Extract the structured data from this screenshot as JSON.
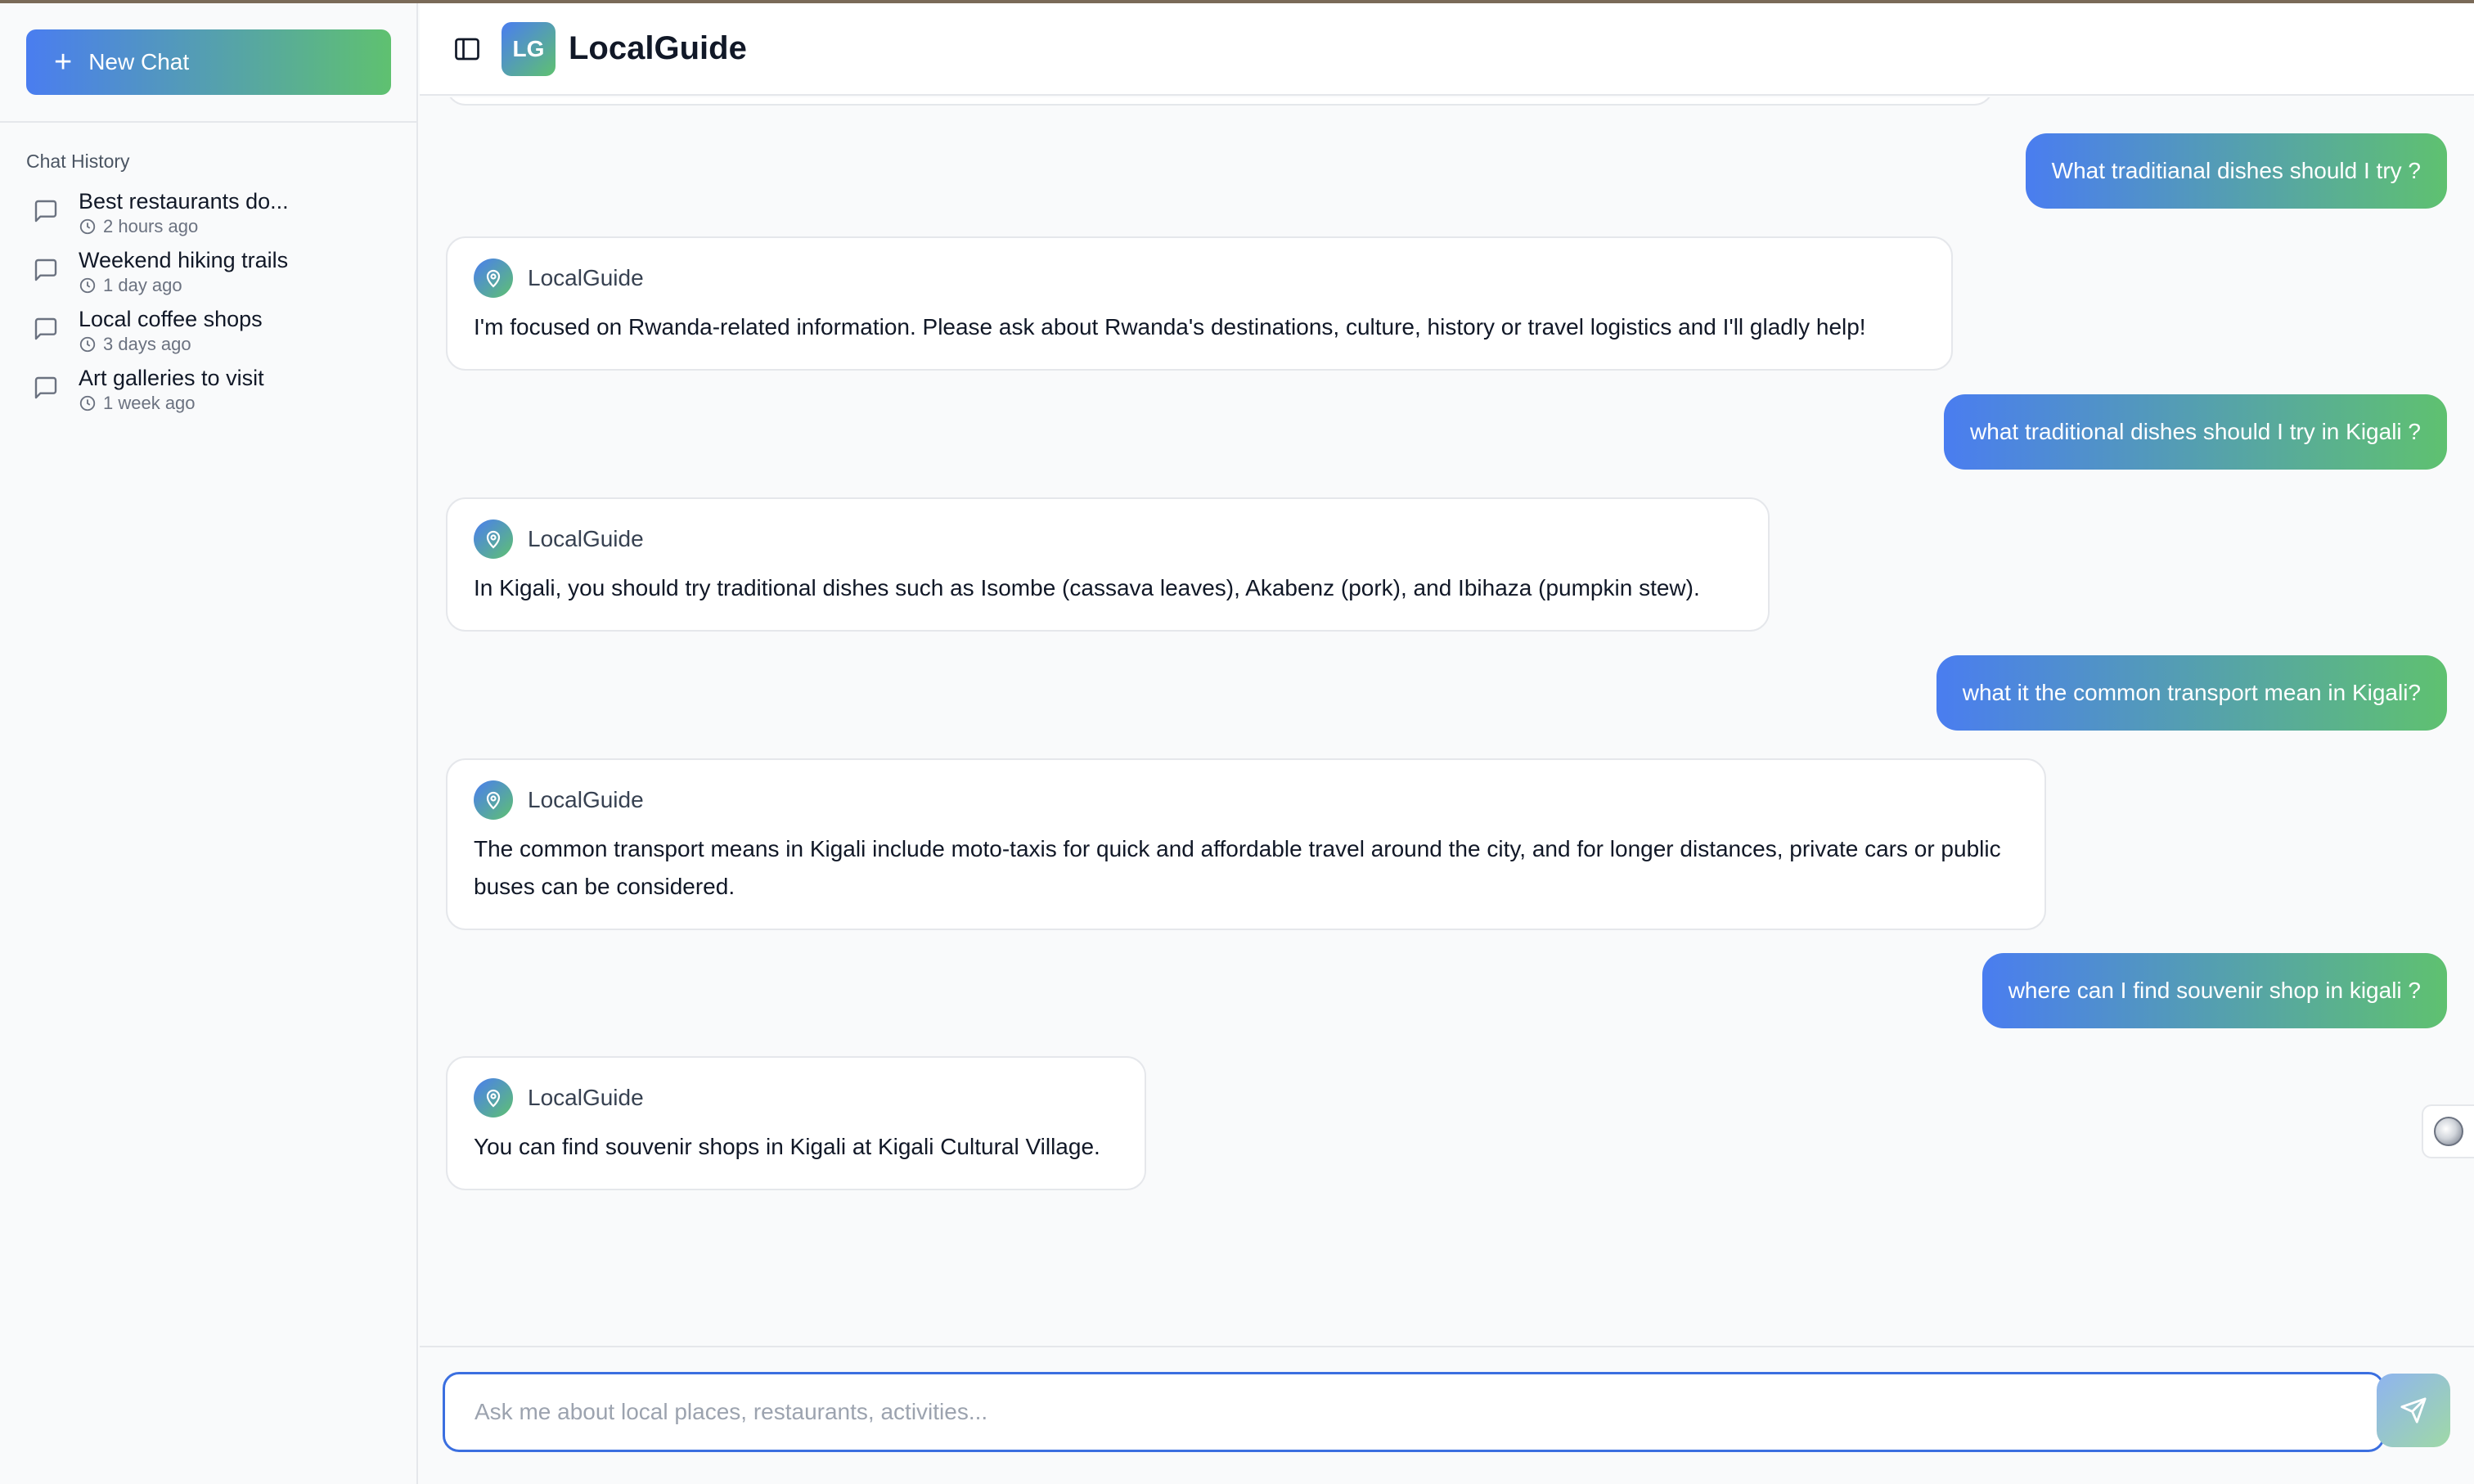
{
  "sidebar": {
    "new_chat_label": "New Chat",
    "history_title": "Chat History",
    "items": [
      {
        "title": "Best restaurants do...",
        "time": "2 hours ago"
      },
      {
        "title": "Weekend hiking trails",
        "time": "1 day ago"
      },
      {
        "title": "Local coffee shops",
        "time": "3 days ago"
      },
      {
        "title": "Art galleries to visit",
        "time": "1 week ago"
      }
    ]
  },
  "header": {
    "logo_text": "LG",
    "title": "LocalGuide"
  },
  "chat": {
    "messages": [
      {
        "role": "user",
        "text": "What traditianal dishes should I try ?"
      },
      {
        "role": "bot",
        "sender": "LocalGuide",
        "text": "I'm focused on Rwanda-related information. Please ask about Rwanda's destinations, culture, history or travel logistics and I'll gladly help!"
      },
      {
        "role": "user",
        "text": "what traditional dishes should I try in Kigali ?"
      },
      {
        "role": "bot",
        "sender": "LocalGuide",
        "text": "In Kigali, you should try traditional dishes such as Isombe (cassava leaves), Akabenz (pork), and Ibihaza (pumpkin stew)."
      },
      {
        "role": "user",
        "text": "what it the common transport mean in Kigali?"
      },
      {
        "role": "bot",
        "sender": "LocalGuide",
        "text": "The common transport means in Kigali include moto-taxis for quick and affordable travel around the city, and for longer distances, private cars or public buses can be considered."
      },
      {
        "role": "user",
        "text": "where can I find souvenir shop in kigali ?"
      },
      {
        "role": "bot",
        "sender": "LocalGuide",
        "text": "You can find souvenir shops in Kigali at Kigali Cultural Village."
      }
    ]
  },
  "input": {
    "placeholder": "Ask me about local places, restaurants, activities...",
    "value": ""
  },
  "icons": {
    "new_chat": "plus-icon",
    "history_item": "message-square-icon",
    "time": "clock-icon",
    "toggle": "sidebar-toggle-icon",
    "bot_avatar": "map-pin-icon",
    "send": "send-icon"
  },
  "colors": {
    "gradient_start": "#4a7df0",
    "gradient_end": "#5fc170",
    "input_border": "#3b6fe0"
  }
}
